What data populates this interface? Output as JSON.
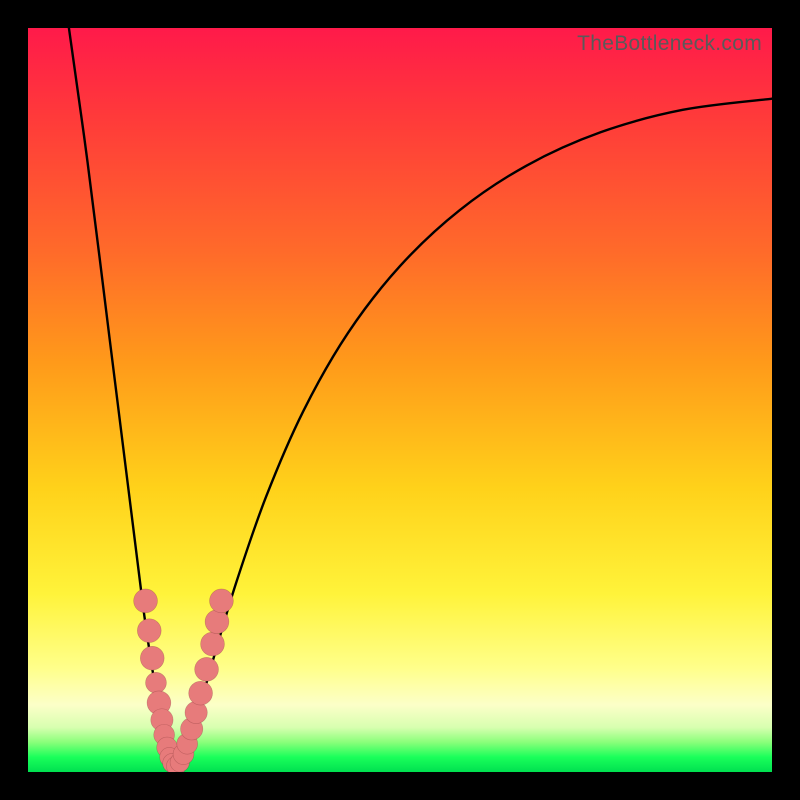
{
  "watermark": "TheBottleneck.com",
  "colors": {
    "gradient_top": "#ff1a4a",
    "gradient_mid_orange": "#ff9a1a",
    "gradient_mid_yellow": "#ffd21a",
    "gradient_bottom_green": "#00e050",
    "curve": "#000000",
    "bead": "#e77b7b",
    "frame": "#000000"
  },
  "chart_data": {
    "type": "line",
    "title": "",
    "xlabel": "",
    "ylabel": "",
    "xlim": [
      0,
      100
    ],
    "ylim": [
      0,
      100
    ],
    "background_gradient": "bottleneck (red=high, green=low)",
    "curve_description": "V-shaped bottleneck curve: steep drop from top-left to a sharp minimum near x≈19, then a long decelerating rise toward upper-right.",
    "curve_points": [
      {
        "x": 5.5,
        "y": 100.0
      },
      {
        "x": 8.0,
        "y": 82.0
      },
      {
        "x": 11.0,
        "y": 58.0
      },
      {
        "x": 13.5,
        "y": 38.0
      },
      {
        "x": 15.5,
        "y": 22.0
      },
      {
        "x": 17.0,
        "y": 12.0
      },
      {
        "x": 18.0,
        "y": 6.0
      },
      {
        "x": 18.8,
        "y": 2.0
      },
      {
        "x": 19.3,
        "y": 0.4
      },
      {
        "x": 19.8,
        "y": 0.2
      },
      {
        "x": 20.5,
        "y": 1.0
      },
      {
        "x": 21.5,
        "y": 3.5
      },
      {
        "x": 23.0,
        "y": 8.5
      },
      {
        "x": 25.0,
        "y": 15.5
      },
      {
        "x": 28.0,
        "y": 25.5
      },
      {
        "x": 32.0,
        "y": 37.0
      },
      {
        "x": 37.0,
        "y": 48.5
      },
      {
        "x": 43.0,
        "y": 59.0
      },
      {
        "x": 50.0,
        "y": 68.0
      },
      {
        "x": 58.0,
        "y": 75.5
      },
      {
        "x": 67.0,
        "y": 81.5
      },
      {
        "x": 77.0,
        "y": 86.0
      },
      {
        "x": 88.0,
        "y": 89.0
      },
      {
        "x": 100.0,
        "y": 90.5
      }
    ],
    "bead_cluster_description": "Pink circular markers clustered on both arms of the V near the bottom (roughly y in 2–25).",
    "beads": [
      {
        "x": 15.8,
        "y": 23.0,
        "r": 1.6
      },
      {
        "x": 16.3,
        "y": 19.0,
        "r": 1.6
      },
      {
        "x": 16.7,
        "y": 15.3,
        "r": 1.6
      },
      {
        "x": 17.2,
        "y": 12.0,
        "r": 1.4
      },
      {
        "x": 17.6,
        "y": 9.3,
        "r": 1.6
      },
      {
        "x": 18.0,
        "y": 7.0,
        "r": 1.5
      },
      {
        "x": 18.3,
        "y": 5.0,
        "r": 1.4
      },
      {
        "x": 18.7,
        "y": 3.3,
        "r": 1.4
      },
      {
        "x": 19.0,
        "y": 2.0,
        "r": 1.3
      },
      {
        "x": 19.4,
        "y": 1.2,
        "r": 1.3
      },
      {
        "x": 19.9,
        "y": 0.8,
        "r": 1.3
      },
      {
        "x": 20.4,
        "y": 1.3,
        "r": 1.3
      },
      {
        "x": 20.9,
        "y": 2.4,
        "r": 1.4
      },
      {
        "x": 21.4,
        "y": 3.8,
        "r": 1.4
      },
      {
        "x": 22.0,
        "y": 5.8,
        "r": 1.5
      },
      {
        "x": 22.6,
        "y": 8.0,
        "r": 1.5
      },
      {
        "x": 23.2,
        "y": 10.6,
        "r": 1.6
      },
      {
        "x": 24.0,
        "y": 13.8,
        "r": 1.6
      },
      {
        "x": 24.8,
        "y": 17.2,
        "r": 1.6
      },
      {
        "x": 25.4,
        "y": 20.2,
        "r": 1.6
      },
      {
        "x": 26.0,
        "y": 23.0,
        "r": 1.6
      }
    ]
  }
}
